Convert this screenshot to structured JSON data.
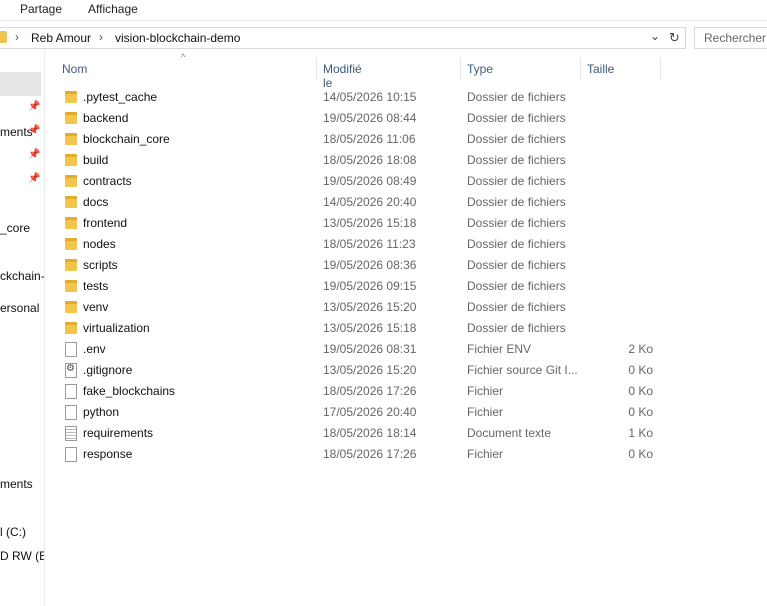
{
  "ribbon": {
    "tabs": [
      "Partage",
      "Affichage"
    ]
  },
  "address": {
    "crumbs": [
      "Reb Amour",
      "vision-blockchain-demo"
    ],
    "search_placeholder": "Rechercher"
  },
  "nav": {
    "items": [
      "ments",
      "_core",
      "ckchain-d",
      "ersonal",
      "ments",
      "l (C:)",
      "D RW (E:"
    ]
  },
  "columns": {
    "name": "Nom",
    "modified": "Modifié le",
    "type": "Type",
    "size": "Taille"
  },
  "files": [
    {
      "name": ".pytest_cache",
      "date": "14/05/2026 10:15",
      "type": "Dossier de fichiers",
      "size": "",
      "icon": "folder-icon"
    },
    {
      "name": "backend",
      "date": "19/05/2026 08:44",
      "type": "Dossier de fichiers",
      "size": "",
      "icon": "folder-icon"
    },
    {
      "name": "blockchain_core",
      "date": "18/05/2026 11:06",
      "type": "Dossier de fichiers",
      "size": "",
      "icon": "folder-icon"
    },
    {
      "name": "build",
      "date": "18/05/2026 18:08",
      "type": "Dossier de fichiers",
      "size": "",
      "icon": "folder-icon"
    },
    {
      "name": "contracts",
      "date": "19/05/2026 08:49",
      "type": "Dossier de fichiers",
      "size": "",
      "icon": "folder-icon"
    },
    {
      "name": "docs",
      "date": "14/05/2026 20:40",
      "type": "Dossier de fichiers",
      "size": "",
      "icon": "folder-icon"
    },
    {
      "name": "frontend",
      "date": "13/05/2026 15:18",
      "type": "Dossier de fichiers",
      "size": "",
      "icon": "folder-icon"
    },
    {
      "name": "nodes",
      "date": "18/05/2026 11:23",
      "type": "Dossier de fichiers",
      "size": "",
      "icon": "folder-icon"
    },
    {
      "name": "scripts",
      "date": "19/05/2026 08:36",
      "type": "Dossier de fichiers",
      "size": "",
      "icon": "folder-icon"
    },
    {
      "name": "tests",
      "date": "19/05/2026 09:15",
      "type": "Dossier de fichiers",
      "size": "",
      "icon": "folder-icon"
    },
    {
      "name": "venv",
      "date": "13/05/2026 15:20",
      "type": "Dossier de fichiers",
      "size": "",
      "icon": "folder-icon"
    },
    {
      "name": "virtualization",
      "date": "13/05/2026 15:18",
      "type": "Dossier de fichiers",
      "size": "",
      "icon": "folder-icon"
    },
    {
      "name": ".env",
      "date": "19/05/2026 08:31",
      "type": "Fichier ENV",
      "size": "2 Ko",
      "icon": "env-file-icon"
    },
    {
      "name": ".gitignore",
      "date": "13/05/2026 15:20",
      "type": "Fichier source Git I...",
      "size": "0 Ko",
      "icon": "git-file-icon"
    },
    {
      "name": "fake_blockchains",
      "date": "18/05/2026 17:26",
      "type": "Fichier",
      "size": "0 Ko",
      "icon": "file-icon"
    },
    {
      "name": "python",
      "date": "17/05/2026 20:40",
      "type": "Fichier",
      "size": "0 Ko",
      "icon": "file-icon"
    },
    {
      "name": "requirements",
      "date": "18/05/2026 18:14",
      "type": "Document texte",
      "size": "1 Ko",
      "icon": "text-file-icon"
    },
    {
      "name": "response",
      "date": "18/05/2026 17:26",
      "type": "Fichier",
      "size": "0 Ko",
      "icon": "file-icon"
    }
  ]
}
